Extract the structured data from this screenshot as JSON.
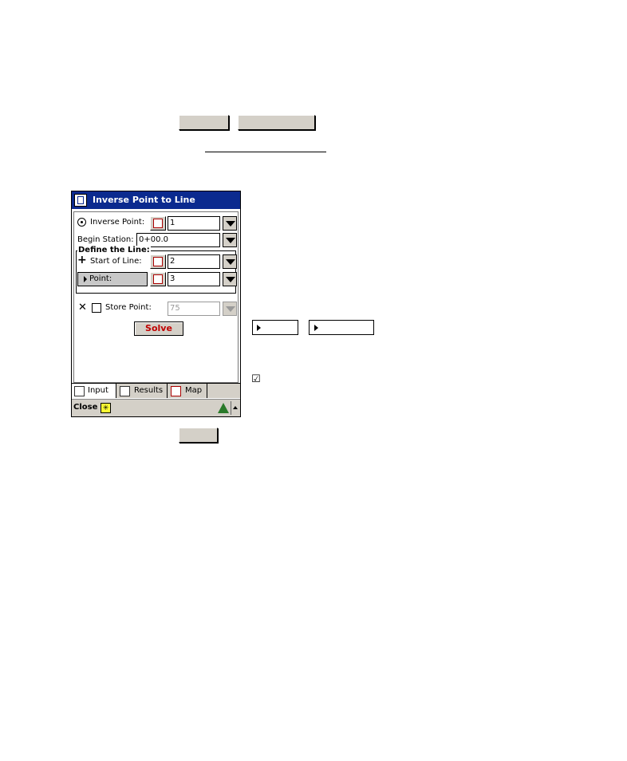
{
  "window": {
    "title": "Inverse Point to Line",
    "inverse_point_label": "Inverse Point:",
    "inverse_point_value": "1",
    "begin_station_label": "Begin Station:",
    "begin_station_value": "0+00.0",
    "define_line_title": "Define the Line:",
    "start_of_line_label": "Start of Line:",
    "start_of_line_value": "2",
    "point_label": "Point:",
    "point_value": "3",
    "store_point_label": "Store Point:",
    "store_point_value": "75",
    "solve_label": "Solve",
    "tabs": [
      {
        "label": "Input"
      },
      {
        "label": "Results"
      },
      {
        "label": "Map"
      }
    ],
    "close_label": "Close",
    "star_glyph": "✳"
  },
  "callouts": {
    "checkbox_glyph": "☑"
  },
  "colors": {
    "titlebar": "#0b2a8f",
    "solve_text": "#c00000",
    "chrome": "#d4d0c8"
  }
}
